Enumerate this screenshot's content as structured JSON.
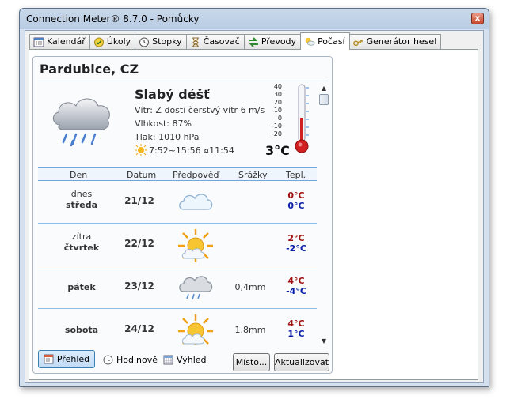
{
  "window": {
    "title": "Connection Meter® 8.7.0 - Pomůcky",
    "close_symbol": "x"
  },
  "tabs": [
    {
      "label": "Kalendář",
      "icon": "calendar-icon",
      "active": false
    },
    {
      "label": "Úkoly",
      "icon": "tasks-icon",
      "active": false
    },
    {
      "label": "Stopky",
      "icon": "stopwatch-icon",
      "active": false
    },
    {
      "label": "Časovač",
      "icon": "hourglass-icon",
      "active": false
    },
    {
      "label": "Převody",
      "icon": "convert-icon",
      "active": false
    },
    {
      "label": "Počasí",
      "icon": "weather-icon",
      "active": true
    },
    {
      "label": "Generátor hesel",
      "icon": "key-icon",
      "active": false
    }
  ],
  "weather": {
    "city": "Pardubice, CZ",
    "condition": "Slabý déšť",
    "wind": "Vítr: Z dosti čerstvý vítr 6 m/s",
    "humidity": "Vlhkost: 87%",
    "pressure": "Tlak: 1010 hPa",
    "sun": "7:52~15:56 ¤11:54",
    "temperature": "3°C",
    "temperature_value": 3,
    "scale": [
      "40",
      "30",
      "20",
      "10",
      "0",
      "-10",
      "-20"
    ],
    "colors": {
      "high": "#a01010",
      "low": "#0a1ea8",
      "separator": "#8fbde6"
    }
  },
  "forecast": {
    "headers": {
      "day": "Den",
      "date": "Datum",
      "forecast": "Předpověď",
      "precip": "Srážky",
      "temp": "Tepl."
    },
    "rows": [
      {
        "day_top": "dnes",
        "day": "středa",
        "date": "21/12",
        "icon": "cloudy-icon",
        "precip": "",
        "high": "0°C",
        "low": "0°C"
      },
      {
        "day_top": "zítra",
        "day": "čtvrtek",
        "date": "22/12",
        "icon": "sunny-icon",
        "precip": "",
        "high": "2°C",
        "low": "-2°C"
      },
      {
        "day_top": "",
        "day": "pátek",
        "date": "23/12",
        "icon": "rain-cloud-icon",
        "precip": "0,4mm",
        "high": "4°C",
        "low": "-4°C"
      },
      {
        "day_top": "",
        "day": "sobota",
        "date": "24/12",
        "icon": "sunny-icon",
        "precip": "1,8mm",
        "high": "4°C",
        "low": "1°C"
      }
    ]
  },
  "bottom": {
    "overview": "Přehled",
    "hourly": "Hodinově",
    "outlook": "Výhled",
    "place": "Místo...",
    "refresh": "Aktualizovat"
  }
}
